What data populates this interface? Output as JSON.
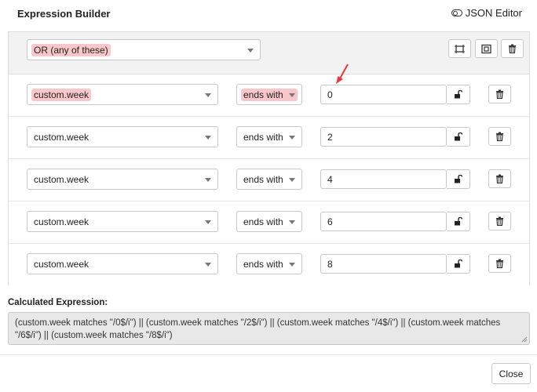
{
  "header": {
    "title": "Expression Builder",
    "json_editor_label": "JSON Editor"
  },
  "group": {
    "operator": "OR (any of these)"
  },
  "rules": [
    {
      "field": "custom.week",
      "op": "ends with",
      "value": "0"
    },
    {
      "field": "custom.week",
      "op": "ends with",
      "value": "2"
    },
    {
      "field": "custom.week",
      "op": "ends with",
      "value": "4"
    },
    {
      "field": "custom.week",
      "op": "ends with",
      "value": "6"
    },
    {
      "field": "custom.week",
      "op": "ends with",
      "value": "8"
    }
  ],
  "calculated": {
    "label": "Calculated Expression:",
    "value": "(custom.week matches \"/0$/i\") || (custom.week matches \"/2$/i\") || (custom.week matches \"/4$/i\") || (custom.week matches \"/6$/i\") || (custom.week matches \"/8$/i\")"
  },
  "footer": {
    "close_label": "Close"
  },
  "colors": {
    "highlight": "#f9c7c9",
    "annotation_arrow": "#e8383a"
  },
  "icons": {
    "add_rule": "add-rule-icon",
    "add_group": "add-group-icon",
    "delete": "trash-icon",
    "lock": "unlock-icon",
    "toggle": "toggle-icon"
  }
}
